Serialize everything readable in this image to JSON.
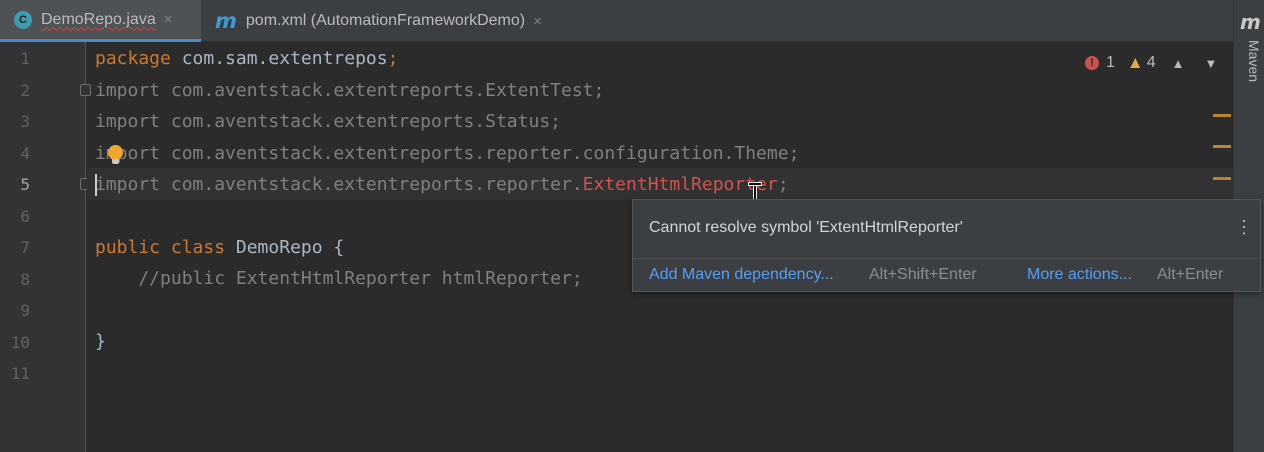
{
  "tabs": [
    {
      "title": "DemoRepo.java",
      "icon": "C",
      "close": "×"
    },
    {
      "title": "pom.xml (AutomationFrameworkDemo)",
      "icon": "m",
      "close": "×"
    }
  ],
  "sidebar": {
    "logo": "m",
    "label": "Maven"
  },
  "inspection": {
    "errors": "1",
    "warnings": "4",
    "up": "⌃",
    "down": "⌄"
  },
  "gutter": {
    "line_numbers": [
      "1",
      "2",
      "3",
      "4",
      "5",
      "6",
      "7",
      "8",
      "9",
      "10",
      "11"
    ]
  },
  "code": {
    "l1_kw": "package",
    "l1_rest": " com.sam.extentrepos",
    "l1_semi": ";",
    "l2": "import com.aventstack.extentreports.ExtentTest;",
    "l3": "import com.aventstack.extentreports.Status;",
    "l4": "import com.aventstack.extentreports.reporter.configuration.Theme;",
    "l5_pre": "import com.aventstack.extentreports.reporter.",
    "l5_err": "ExtentHtmlReporter",
    "l5_post": ";",
    "l7_kw": "public class",
    "l7_rest": " DemoRepo {",
    "l8": "    //public ExtentHtmlReporter htmlReporter;",
    "l10": "}"
  },
  "popup": {
    "message": "Cannot resolve symbol 'ExtentHtmlReporter'",
    "more_icon": "⋮",
    "action1": "Add Maven dependency...",
    "shortcut1": "Alt+Shift+Enter",
    "action2": "More actions...",
    "shortcut2": "Alt+Enter"
  },
  "colors": {
    "background": "#2b2b2b",
    "keyword": "#cc7832",
    "error": "#d25252",
    "link": "#589df6",
    "warning": "#e0a84b"
  }
}
